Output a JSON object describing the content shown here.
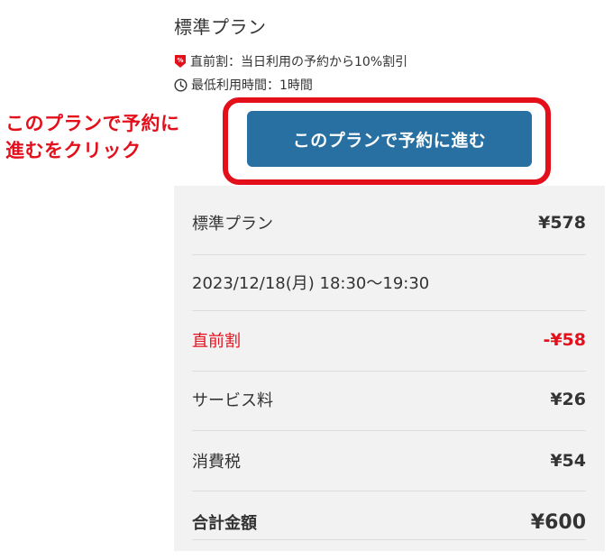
{
  "plan": {
    "title": "標準プラン",
    "discount_info": "直前割：当日利用の予約から10%割引",
    "min_duration": "最低利用時間：1時間",
    "discount_icon": "discount-tag-icon",
    "clock_icon": "clock-icon"
  },
  "annotation": {
    "line1": "このプランで予約に",
    "line2": "進むをクリック"
  },
  "cta": {
    "label": "このプランで予約に進む"
  },
  "summary": {
    "rows": [
      {
        "label": "標準プラン",
        "amount": "¥578"
      },
      {
        "label": "2023/12/18(月) 18:30〜19:30",
        "amount": ""
      },
      {
        "label": "直前割",
        "amount": "-¥58"
      },
      {
        "label": "サービス料",
        "amount": "¥26"
      },
      {
        "label": "消費税",
        "amount": "¥54"
      },
      {
        "label": "合計金額",
        "amount": "¥600"
      }
    ]
  },
  "colors": {
    "accent_red": "#e3101c",
    "button_blue": "#2870a1",
    "panel_bg": "#f2f2f2"
  }
}
